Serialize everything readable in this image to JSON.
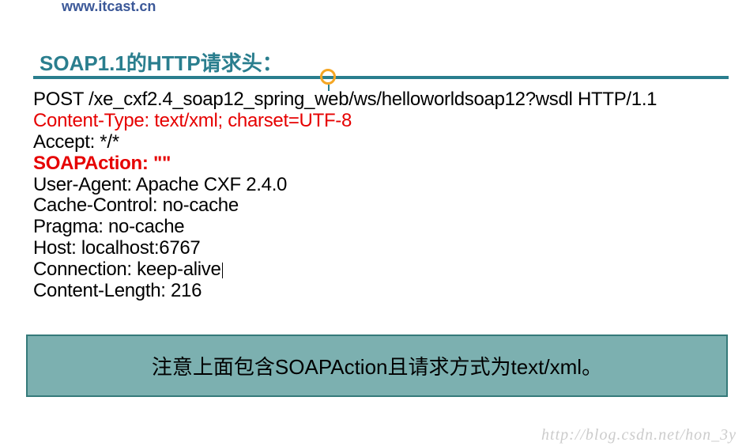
{
  "top_url": "www.itcast.cn",
  "title_part1": "SOAP1.1",
  "title_part2": "的",
  "title_part3": "HTTP",
  "title_part4": "请求头：",
  "headers": {
    "line1": " POST /xe_cxf2.4_soap12_spring_web/ws/helloworldsoap12?wsdl HTTP/1.1",
    "line2": "Content-Type: text/xml; charset=UTF-8",
    "line3": "Accept: */*",
    "line4": "SOAPAction: \"\"",
    "line5": "User-Agent: Apache CXF 2.4.0",
    "line6": "Cache-Control: no-cache",
    "line7": "Pragma: no-cache",
    "line8": "Host: localhost:6767",
    "line9": "Connection: keep-alive",
    "line10": "Content-Length: 216"
  },
  "note_text": "注意上面包含SOAPAction且请求方式为text/xml。",
  "watermark": "http://blog.csdn.net/hon_3y"
}
